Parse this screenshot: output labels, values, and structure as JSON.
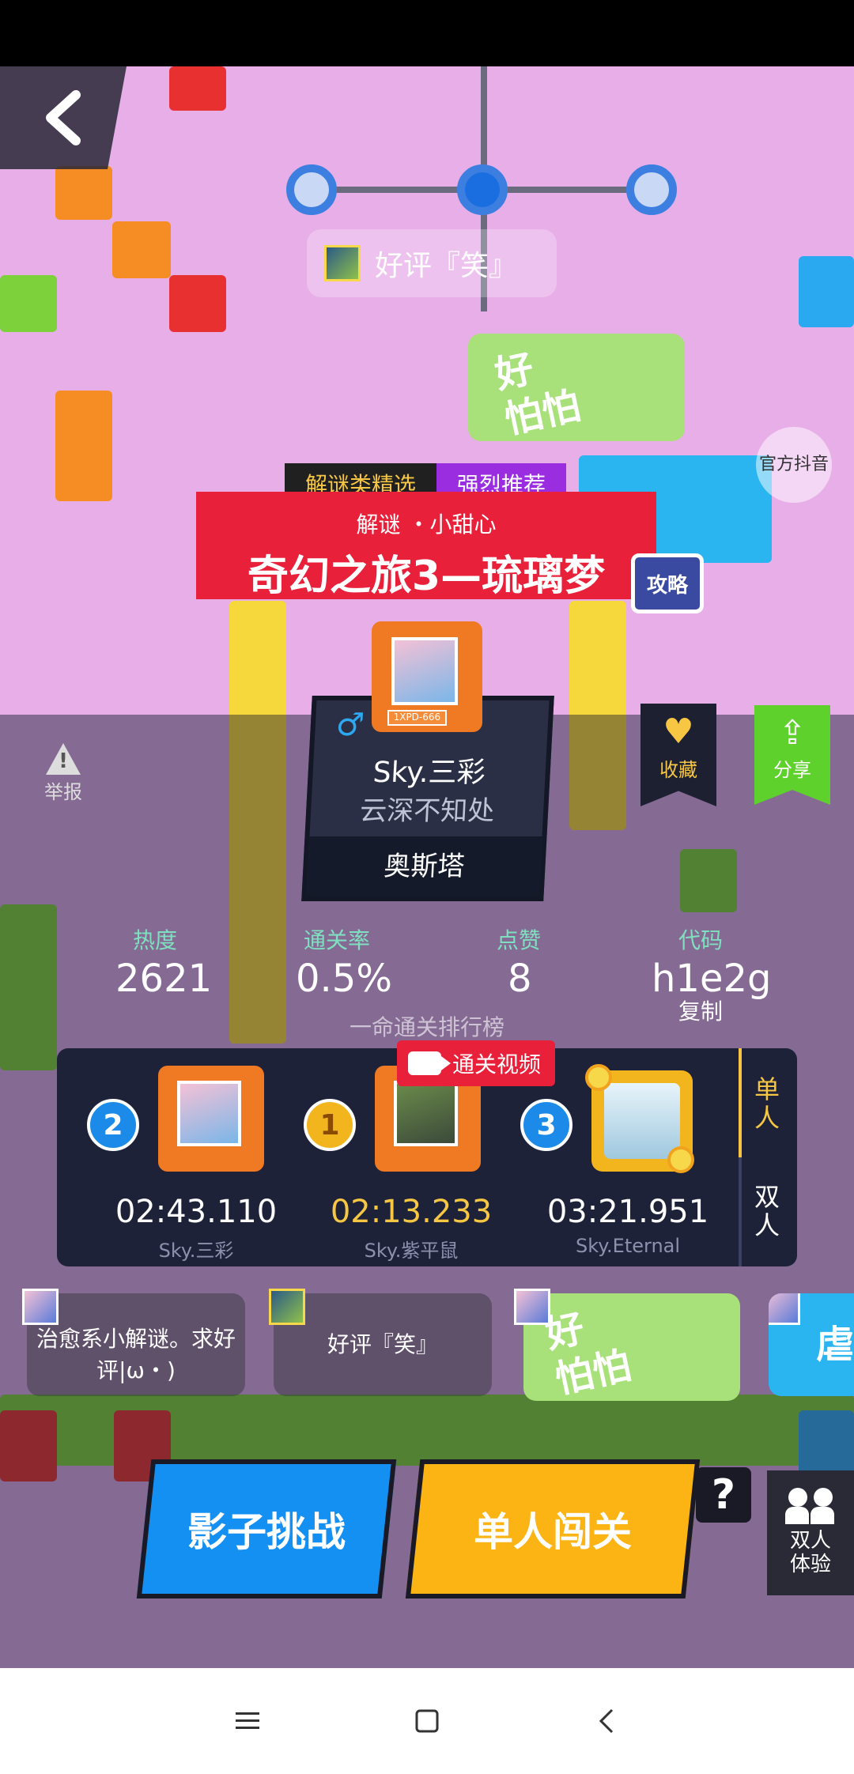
{
  "map": {
    "sign_text": "好评『笑』",
    "scared_text_1": "好",
    "scared_text_2": "怕怕",
    "official_text": "官方抖音",
    "guide_label": "攻略"
  },
  "level": {
    "badge_category": "解谜类精选",
    "badge_recommend": "强烈推荐",
    "tags": "解谜 ・小甜心",
    "title": "奇幻之旅3—琉璃梦"
  },
  "author": {
    "gender_symbol": "♂",
    "name": "Sky.三彩",
    "signature": "云深不知处",
    "location": "奥斯塔",
    "avatar_tag": "1XPD-666"
  },
  "actions": {
    "report_label": "举报",
    "favorite_label": "收藏",
    "share_label": "分享"
  },
  "stats": {
    "heat_label": "热度",
    "heat_value": "2621",
    "clear_rate_label": "通关率",
    "clear_rate_value": "0.5%",
    "likes_label": "点赞",
    "likes_value": "8",
    "code_label": "代码",
    "code_value": "h1e2g",
    "copy_label": "复制"
  },
  "leaderboard": {
    "title": "一命通关排行榜",
    "video_label": "通关视频",
    "mode_single": "单人",
    "mode_double": "双人",
    "entries": [
      {
        "rank": "2",
        "time": "02:43.110",
        "name": "Sky.三彩"
      },
      {
        "rank": "1",
        "time": "02:13.233",
        "name": "Sky.紫平鼠"
      },
      {
        "rank": "3",
        "time": "03:21.951",
        "name": "Sky.Eternal"
      }
    ]
  },
  "bottom_tags": {
    "tag1": "治愈系小解谜。求好评|ω・)",
    "tag2": "好评『笑』",
    "tag3_line1": "好",
    "tag3_line2": "怕怕",
    "tag4": "虐哭"
  },
  "buttons": {
    "shadow_challenge": "影子挑战",
    "single_play": "单人闯关",
    "help": "?",
    "duo_experience": "双人体验"
  },
  "colors": {
    "accent_red": "#e8203a",
    "accent_yellow": "#fbb414",
    "accent_blue": "#1490f2",
    "panel_dark": "#1d2238",
    "stat_label_green": "#7fe0c0"
  }
}
